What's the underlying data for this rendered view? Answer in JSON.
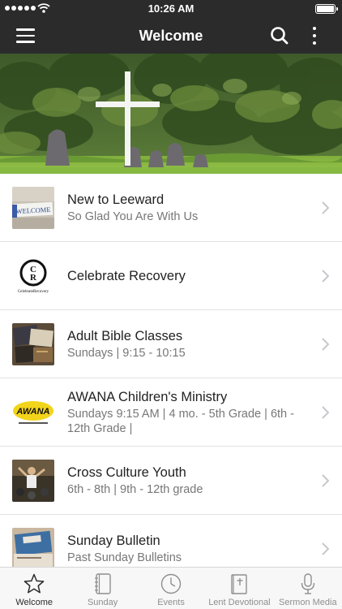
{
  "status_bar": {
    "time": "10:26 AM"
  },
  "nav": {
    "title": "Welcome"
  },
  "colors": {
    "nav_bg": "#2b2b2b",
    "row_title": "#222222",
    "row_subtitle": "#777777",
    "tab_inactive": "#8e8e8e"
  },
  "hero": {
    "icon": "cross-landscape-image"
  },
  "list": {
    "items": [
      {
        "title": "New to Leeward",
        "subtitle": "So Glad You Are With Us",
        "thumb_text": "WELCOME"
      },
      {
        "title": "Celebrate Recovery",
        "subtitle": "",
        "thumb_text": "CelebrateRecovery",
        "logo_letters": "CR"
      },
      {
        "title": "Adult Bible Classes",
        "subtitle": "Sundays | 9:15 - 10:15"
      },
      {
        "title": "AWANA Children's Ministry",
        "subtitle": "Sundays 9:15 AM | 4 mo. - 5th Grade | 6th - 12th Grade |",
        "thumb_text": "AWANA"
      },
      {
        "title": "Cross Culture Youth",
        "subtitle": "6th - 8th | 9th - 12th grade"
      },
      {
        "title": "Sunday Bulletin",
        "subtitle": "Past Sunday Bulletins"
      }
    ]
  },
  "tabs": [
    {
      "label": "Welcome",
      "icon": "star-icon",
      "active": true
    },
    {
      "label": "Sunday",
      "icon": "notebook-icon",
      "active": false
    },
    {
      "label": "Events",
      "icon": "clock-icon",
      "active": false
    },
    {
      "label": "Lent Devotional",
      "icon": "bible-icon",
      "active": false
    },
    {
      "label": "Sermon Media",
      "icon": "microphone-icon",
      "active": false
    }
  ]
}
